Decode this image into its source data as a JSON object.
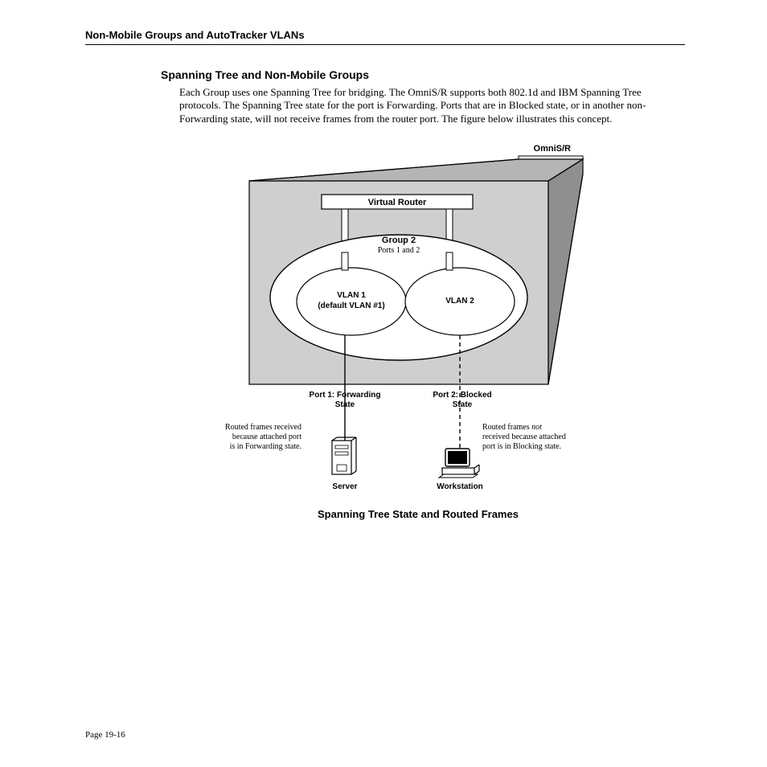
{
  "header": {
    "running_head": "Non-Mobile Groups and AutoTracker VLANs"
  },
  "section": {
    "title": "Spanning Tree and Non-Mobile Groups",
    "body_html": "Each Group uses one Spanning Tree for bridging. The OmniS/R supports both 802.1d and IBM Spanning Tree protocols. The Spanning Tree state for the port is Forwarding. Ports that are in Blocked state, or in another non-Forwarding state, will not receive frames from the router port. The figure below illustrates this concept."
  },
  "diagram": {
    "omnisr": "OmniS/R",
    "virtual_router": "Virtual Router",
    "group_title": "Group 2",
    "group_sub": "Ports 1 and 2",
    "vlan1_line1": "VLAN 1",
    "vlan1_line2": "(default VLAN #1)",
    "vlan2": "VLAN 2",
    "port1_line1": "Port 1: Forwarding",
    "port1_line2": "State",
    "port2_line1": "Port 2: Blocked",
    "port2_line2": "State",
    "left_note_l1": "Routed frames received",
    "left_note_l2": "because attached port",
    "left_note_l3": "is in Forwarding state.",
    "right_note_l1a": "Routed frames ",
    "right_note_l1b": "not",
    "right_note_l2": "received because attached",
    "right_note_l3": "port is in Blocking state.",
    "server": "Server",
    "workstation": "Workstation",
    "caption": "Spanning Tree State and Routed Frames"
  },
  "footer": {
    "page": "Page 19-16"
  }
}
